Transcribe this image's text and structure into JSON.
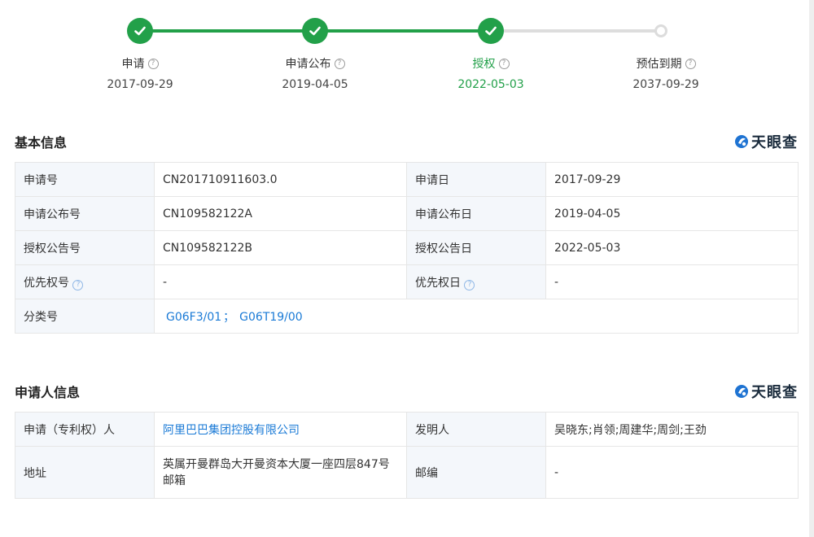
{
  "timeline": [
    {
      "label": "申请",
      "date": "2017-09-29",
      "status": "done"
    },
    {
      "label": "申请公布",
      "date": "2019-04-05",
      "status": "done"
    },
    {
      "label": "授权",
      "date": "2022-05-03",
      "status": "active"
    },
    {
      "label": "预估到期",
      "date": "2037-09-29",
      "status": "pending"
    }
  ],
  "basic": {
    "title": "基本信息",
    "brand": "天眼查",
    "rows": [
      {
        "l1": "申请号",
        "v1": "CN201710911603.0",
        "l2": "申请日",
        "v2": "2017-09-29"
      },
      {
        "l1": "申请公布号",
        "v1": "CN109582122A",
        "l2": "申请公布日",
        "v2": "2019-04-05"
      },
      {
        "l1": "授权公告号",
        "v1": "CN109582122B",
        "l2": "授权公告日",
        "v2": "2022-05-03"
      },
      {
        "l1": "优先权号",
        "v1": "-",
        "l2": "优先权日",
        "v2": "-"
      }
    ],
    "classification": {
      "label": "分类号",
      "codes": [
        "G06F3/01",
        "G06T19/00"
      ],
      "separator": "；"
    }
  },
  "applicant": {
    "title": "申请人信息",
    "brand": "天眼查",
    "rows": [
      {
        "l1": "申请（专利权）人",
        "v1": "阿里巴巴集团控股有限公司",
        "l2": "发明人",
        "v2": "吴晓东;肖领;周建华;周剑;王劲"
      },
      {
        "l1": "地址",
        "v1": "英属开曼群岛大开曼资本大厦一座四层847号邮箱",
        "l2": "邮编",
        "v2": "-"
      }
    ]
  },
  "colors": {
    "accent_green": "#22a049",
    "link_blue": "#1a7ad6",
    "label_bg": "#f4f7fb"
  },
  "icons": {
    "help": "?",
    "check": "check-icon",
    "brand_logo": "tianyancha-logo-icon"
  }
}
